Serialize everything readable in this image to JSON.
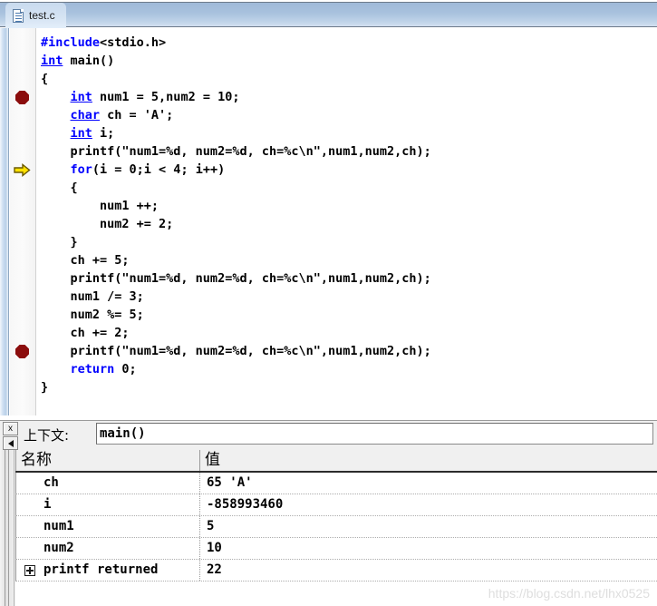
{
  "window": {
    "tab": {
      "label": "test.c",
      "icon": "file-c-icon"
    }
  },
  "editor": {
    "lines": [
      {
        "marker": "none",
        "segments": [
          {
            "t": "#include",
            "c": "pp"
          },
          {
            "t": "<stdio.h>",
            "c": "plain"
          }
        ]
      },
      {
        "marker": "none",
        "segments": [
          {
            "t": "int",
            "c": "kw-u"
          },
          {
            "t": " main()",
            "c": "plain"
          }
        ]
      },
      {
        "marker": "none",
        "segments": [
          {
            "t": "{",
            "c": "plain"
          }
        ]
      },
      {
        "marker": "breakpoint",
        "segments": [
          {
            "t": "    ",
            "c": "plain"
          },
          {
            "t": "int",
            "c": "kw-u"
          },
          {
            "t": " num1 = 5,num2 = 10;",
            "c": "plain"
          }
        ]
      },
      {
        "marker": "none",
        "segments": [
          {
            "t": "    ",
            "c": "plain"
          },
          {
            "t": "char",
            "c": "kw-u"
          },
          {
            "t": " ch = 'A';",
            "c": "plain"
          }
        ]
      },
      {
        "marker": "none",
        "segments": [
          {
            "t": "    ",
            "c": "plain"
          },
          {
            "t": "int",
            "c": "kw-u"
          },
          {
            "t": " i;",
            "c": "plain"
          }
        ]
      },
      {
        "marker": "none",
        "segments": [
          {
            "t": "    printf(\"num1=%d, num2=%d, ch=%c\\n\",num1,num2,ch);",
            "c": "plain"
          }
        ]
      },
      {
        "marker": "arrow",
        "segments": [
          {
            "t": "    ",
            "c": "plain"
          },
          {
            "t": "for",
            "c": "kw"
          },
          {
            "t": "(i = 0;i < 4; i++)",
            "c": "plain"
          }
        ]
      },
      {
        "marker": "none",
        "segments": [
          {
            "t": "    {",
            "c": "plain"
          }
        ]
      },
      {
        "marker": "none",
        "segments": [
          {
            "t": "        num1 ++;",
            "c": "plain"
          }
        ]
      },
      {
        "marker": "none",
        "segments": [
          {
            "t": "        num2 += 2;",
            "c": "plain"
          }
        ]
      },
      {
        "marker": "none",
        "segments": [
          {
            "t": "    }",
            "c": "plain"
          }
        ]
      },
      {
        "marker": "none",
        "segments": [
          {
            "t": "    ch += 5;",
            "c": "plain"
          }
        ]
      },
      {
        "marker": "none",
        "segments": [
          {
            "t": "    printf(\"num1=%d, num2=%d, ch=%c\\n\",num1,num2,ch);",
            "c": "plain"
          }
        ]
      },
      {
        "marker": "none",
        "segments": [
          {
            "t": "    num1 /= 3;",
            "c": "plain"
          }
        ]
      },
      {
        "marker": "none",
        "segments": [
          {
            "t": "    num2 %= 5;",
            "c": "plain"
          }
        ]
      },
      {
        "marker": "none",
        "segments": [
          {
            "t": "    ch += 2;",
            "c": "plain"
          }
        ]
      },
      {
        "marker": "breakpoint",
        "segments": [
          {
            "t": "    printf(\"num1=%d, num2=%d, ch=%c\\n\",num1,num2,ch);",
            "c": "plain"
          }
        ]
      },
      {
        "marker": "none",
        "segments": [
          {
            "t": "    ",
            "c": "plain"
          },
          {
            "t": "return",
            "c": "kw"
          },
          {
            "t": " 0;",
            "c": "plain"
          }
        ]
      },
      {
        "marker": "none",
        "segments": [
          {
            "t": "}",
            "c": "plain"
          }
        ]
      }
    ],
    "colors": {
      "keyword": "#0000ff",
      "text": "#000000",
      "breakpoint": "#8b0d0d",
      "current_line_arrow": "#ffe100"
    }
  },
  "vars_panel": {
    "close_button_label": "x",
    "collapse_button_icon": "triangle-left-icon",
    "context_label": "上下文:",
    "context_value": "main()",
    "columns": [
      "名称",
      "值"
    ],
    "rows": [
      {
        "expander": false,
        "name": "ch",
        "value": "65 'A'"
      },
      {
        "expander": false,
        "name": "i",
        "value": "-858993460"
      },
      {
        "expander": false,
        "name": "num1",
        "value": "5"
      },
      {
        "expander": false,
        "name": "num2",
        "value": "10"
      },
      {
        "expander": true,
        "name": "printf returned",
        "value": "22"
      }
    ]
  },
  "watermark": "https://blog.csdn.net/lhx0525"
}
